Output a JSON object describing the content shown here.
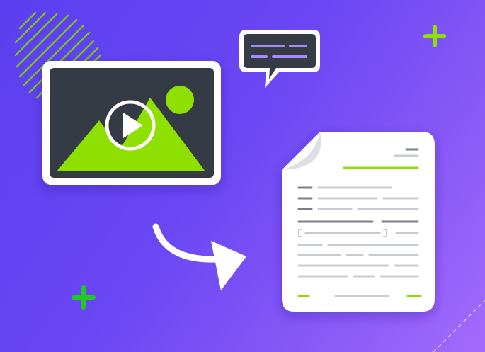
{
  "illustration": {
    "subject": "video-to-document-conversion",
    "icons": [
      "video-thumbnail-icon",
      "chat-bubble-icon",
      "document-icon",
      "arrow-icon",
      "plus-icon",
      "play-icon"
    ]
  },
  "colors": {
    "background_start": "#5b3ff0",
    "background_end": "#a36bfb",
    "accent_green": "#8ee000",
    "bright_green": "#22c922",
    "dark_panel": "#363b45",
    "paper": "#ffffff",
    "lavender": "#a08cff",
    "doc_line_light": "#c8ccd2",
    "doc_line_dark": "#7a7f88"
  }
}
